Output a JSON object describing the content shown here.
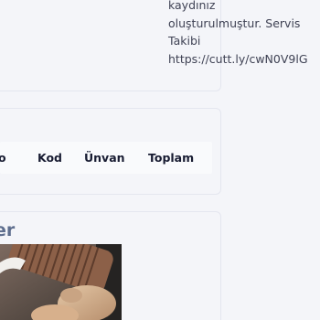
{
  "notification": {
    "lines": [
      "kaydınız",
      "oluşturulmuştur. Servis",
      "Takibi",
      "https://cutt.ly/cwN0V9lG"
    ]
  },
  "table": {
    "headers": [
      "o",
      "Kod",
      "Ünvan",
      "Toplam"
    ]
  },
  "media_card": {
    "title": "er"
  }
}
